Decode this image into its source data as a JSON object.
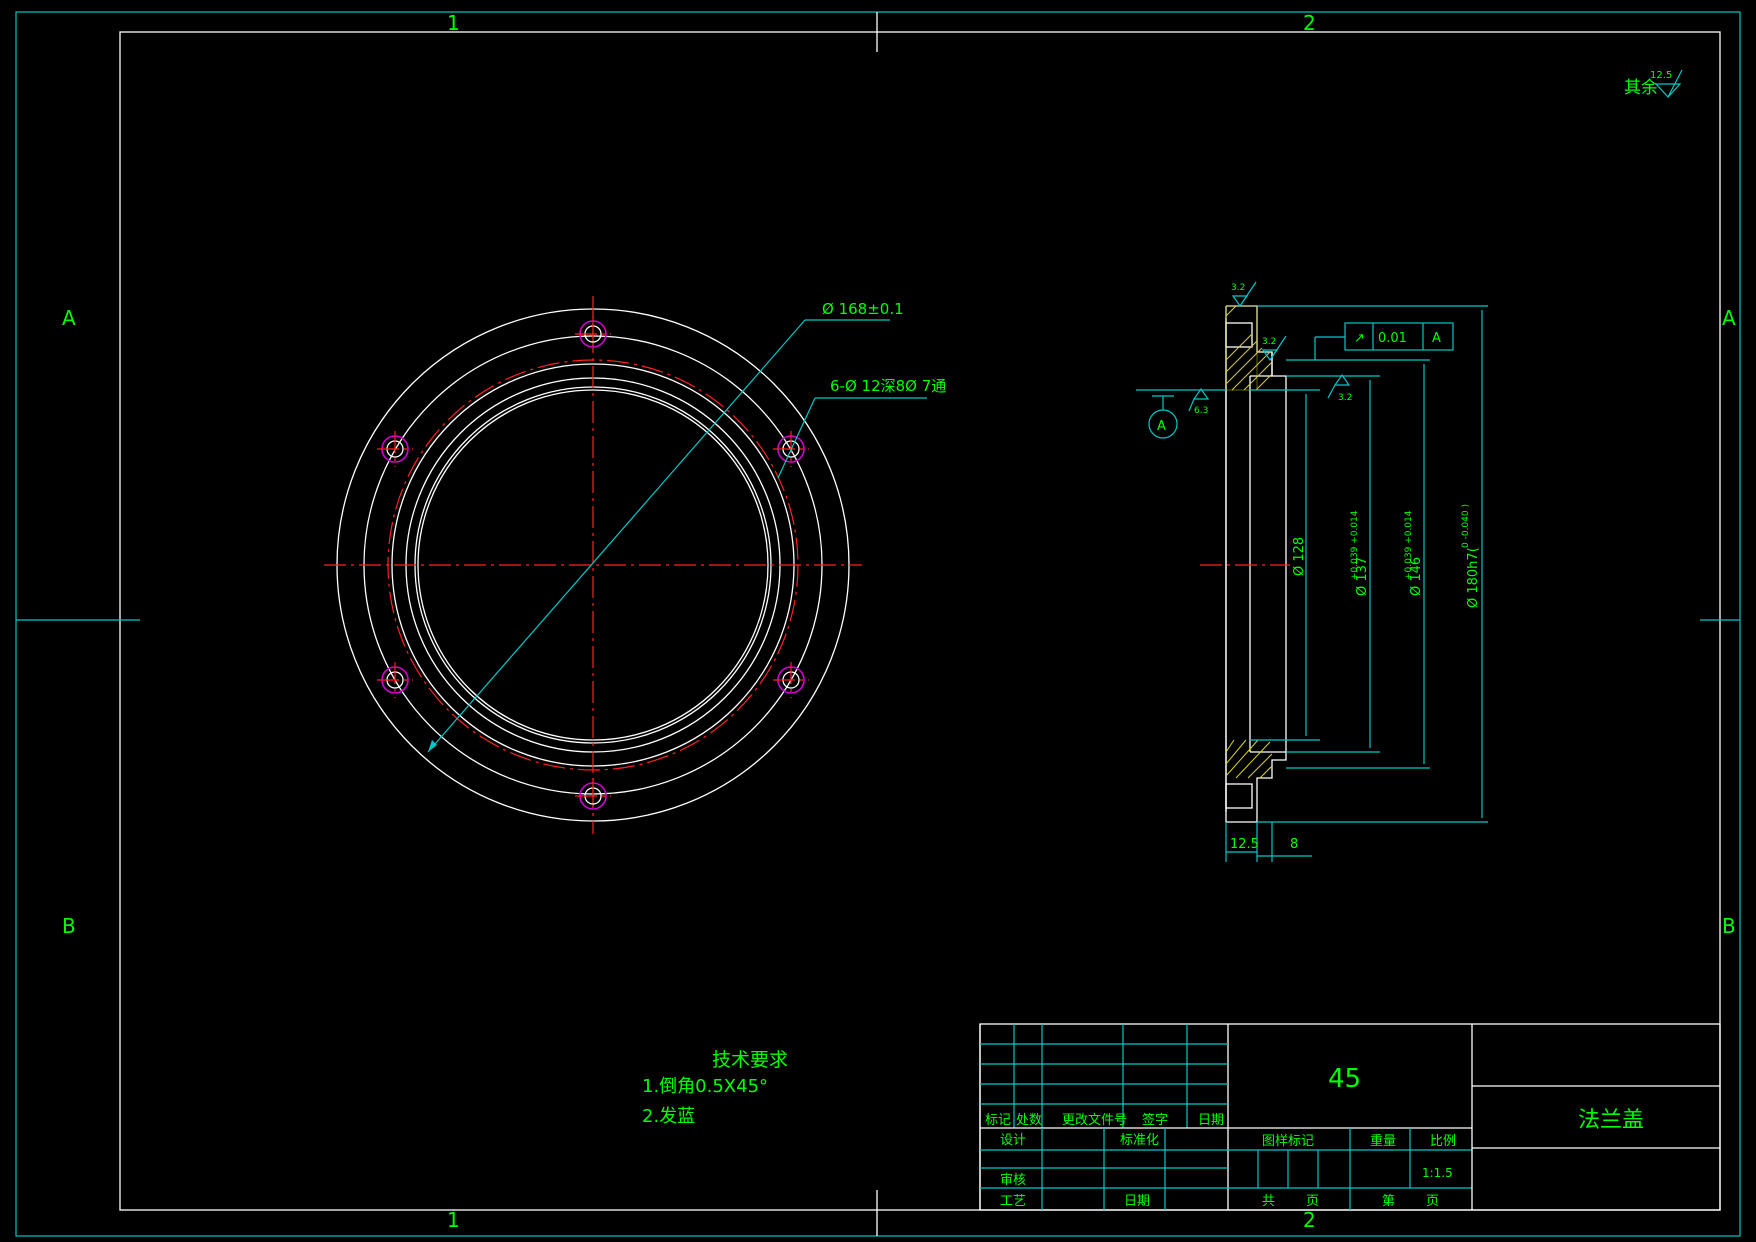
{
  "frame": {
    "top_zone_labels": [
      "1",
      "2"
    ],
    "bottom_zone_labels": [
      "1",
      "2"
    ],
    "left_zone_labels": [
      "A",
      "B"
    ],
    "right_zone_labels": [
      "A",
      "B"
    ]
  },
  "surface_note": {
    "text": "其余",
    "value": "12.5"
  },
  "front_view": {
    "bcd_dim": "Ø 168±0.1",
    "holes_dim": "6-Ø 12深8Ø 7通"
  },
  "side_view": {
    "roughness_top": "3.2",
    "roughness_mid": "3.2",
    "roughness_right": "3.2",
    "roughness_datum": "6.3",
    "datum": "A",
    "fcf_symbol": "↗",
    "fcf_tol": "0.01",
    "fcf_datum": "A",
    "dim_d128": "Ø 128",
    "dim_d137": "Ø 137",
    "dim_d137_tol": "+0.039 +0.014",
    "dim_d146": "Ø 146",
    "dim_d146_tol": "+0.039 +0.014",
    "dim_d180": "Ø 180h7(",
    "dim_d180_tol": "0 -0.040 )",
    "dim_12_5": "12.5",
    "dim_8": "8"
  },
  "tech_req": {
    "title": "技术要求",
    "items": [
      "1.倒角0.5X45°",
      "2.发蓝"
    ]
  },
  "title_block": {
    "material": "45",
    "part_name": "法兰盖",
    "row_headers": [
      "标记",
      "处数",
      "更改文件号",
      "签字",
      "日期"
    ],
    "design": "设计",
    "standardize": "标准化",
    "review": "审核",
    "process": "工艺",
    "date": "日期",
    "stage_mark": "图样标记",
    "weight": "重量",
    "scale_label": "比例",
    "scale": "1:1.5",
    "total": "共",
    "sheets": "页",
    "sheet_no": "第",
    "page": "页"
  }
}
